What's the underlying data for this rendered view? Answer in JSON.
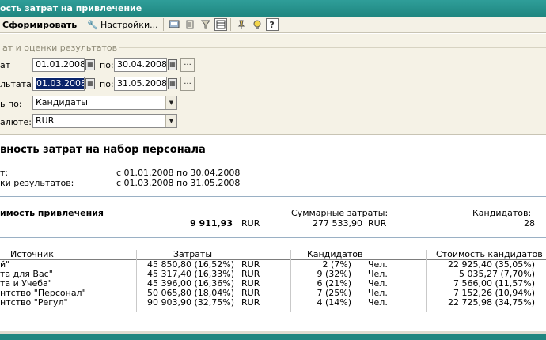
{
  "window": {
    "title": "ость затрат на привлечение"
  },
  "toolbar": {
    "generate_label": "Сформировать",
    "settings_label": "Настройки..."
  },
  "params": {
    "group_title": "ат и оценки результатов",
    "period_label": "ат",
    "period_from": "01.01.2008",
    "period_to": "30.04.2008",
    "result_label": "льтата",
    "result_from": "01.03.2008",
    "result_to": "31.05.2008",
    "to_label": "по:",
    "ellipsis": "...",
    "group_by_label": "ь по:",
    "group_by_value": "Кандидаты",
    "currency_label": "алюте:",
    "currency_value": "RUR"
  },
  "report": {
    "title": "вность затрат на набор персонала",
    "period_label": "т:",
    "period_value": "с 01.01.2008 по 30.04.2008",
    "eval_label": "ки результатов:",
    "eval_value": "с 01.03.2008 по 31.05.2008",
    "cost_label": "имость привлечения",
    "cost_value": "9 911,93",
    "cost_currency": "RUR",
    "total_label": "Суммарные затраты:",
    "total_value": "277 533,90",
    "total_currency": "RUR",
    "candidates_label": "Кандидатов:",
    "candidates_value": "28"
  },
  "table": {
    "headers": {
      "source": "Источник",
      "costs": "Затраты",
      "candidates": "Кандидатов",
      "cost_per": "Стоимость кандидатов"
    },
    "rows": [
      {
        "source": "й\"",
        "costs": "45 850,80 (16,52%)",
        "currency": "RUR",
        "candidates": "2 (7%)",
        "unit": "Чел.",
        "cost_per": "22 925,40 (35,05%)"
      },
      {
        "source": "та для Вас\"",
        "costs": "45 317,40 (16,33%)",
        "currency": "RUR",
        "candidates": "9 (32%)",
        "unit": "Чел.",
        "cost_per": "5 035,27 (7,70%)"
      },
      {
        "source": "та и Учеба\"",
        "costs": "45 396,00 (16,36%)",
        "currency": "RUR",
        "candidates": "6 (21%)",
        "unit": "Чел.",
        "cost_per": "7 566,00 (11,57%)"
      },
      {
        "source": "нтство \"Персонал\"",
        "costs": "50 065,80 (18,04%)",
        "currency": "RUR",
        "candidates": "7 (25%)",
        "unit": "Чел.",
        "cost_per": "7 152,26 (10,94%)"
      },
      {
        "source": "нтство \"Регул\"",
        "costs": "90 903,90 (32,75%)",
        "currency": "RUR",
        "candidates": "4 (14%)",
        "unit": "Чел.",
        "cost_per": "22 725,98 (34,75%)"
      }
    ]
  }
}
